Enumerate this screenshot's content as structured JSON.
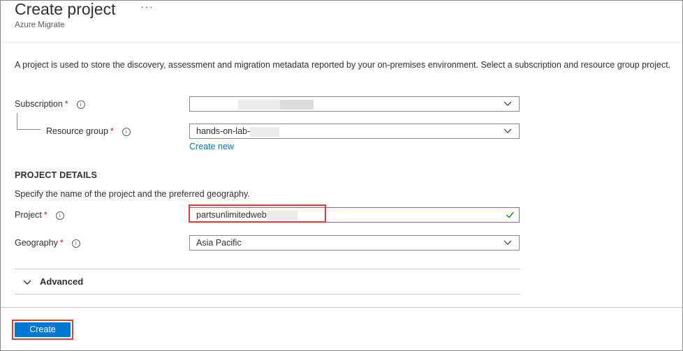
{
  "header": {
    "title": "Create project",
    "ellipsis": "···",
    "subtitle": "Azure Migrate"
  },
  "description": "A project is used to store the discovery, assessment and migration metadata reported by your on-premises environment. Select a subscription and resource group project.",
  "subscription": {
    "label": "Subscription",
    "required_mark": "*",
    "info_icon": "i",
    "value": ""
  },
  "resource_group": {
    "label": "Resource group",
    "required_mark": "*",
    "info_icon": "i",
    "value": "hands-on-lab-",
    "create_new_link": "Create new"
  },
  "project_details": {
    "section_title": "PROJECT DETAILS",
    "instruction": "Specify the name of the project and the preferred geography.",
    "project": {
      "label": "Project",
      "required_mark": "*",
      "info_icon": "i",
      "value": "partsunlimitedweb"
    },
    "geography": {
      "label": "Geography",
      "required_mark": "*",
      "info_icon": "i",
      "value": "Asia Pacific"
    }
  },
  "advanced": {
    "label": "Advanced",
    "expanded": false
  },
  "footer": {
    "create_label": "Create"
  },
  "colors": {
    "primary_button": "#0078d4",
    "link": "#0078d4",
    "required": "#a4262c",
    "highlight_box": "#e03c3c",
    "valid_check": "#107c10",
    "focused_input_border": "#8764b8"
  },
  "icons": {
    "more": "more-actions-icon",
    "info": "info-icon",
    "dropdown": "chevron-down-icon",
    "valid": "checkmark-icon",
    "expand": "chevron-down-icon"
  }
}
